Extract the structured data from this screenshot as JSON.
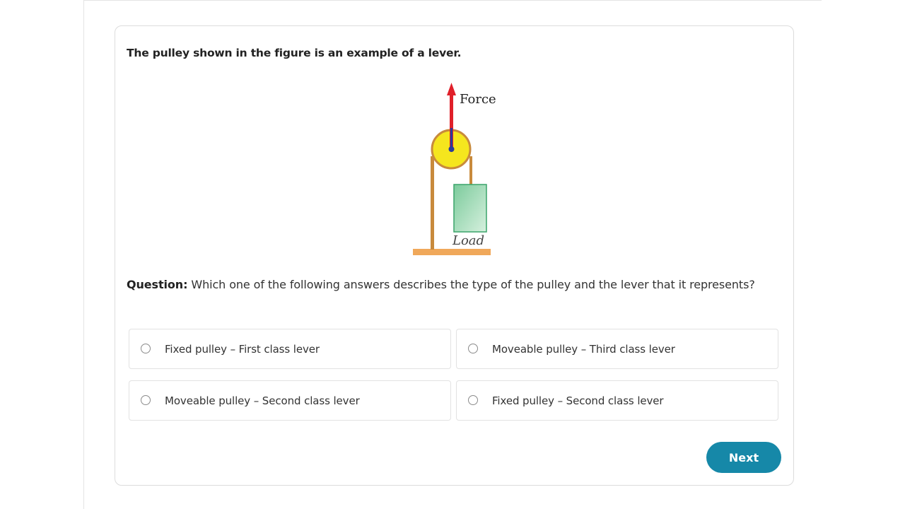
{
  "question_card": {
    "statement": "The pulley shown in the figure is an example of a lever.",
    "figure": {
      "force_label": "Force",
      "load_label": "Load"
    },
    "question_label": "Question:",
    "question_text": " Which one of the following answers describes the type of the pulley and the lever that it represents?",
    "options": [
      {
        "label": "Fixed pulley – First class lever",
        "selected": false
      },
      {
        "label": "Moveable pulley – Third class lever",
        "selected": false
      },
      {
        "label": "Moveable pulley – Second class lever",
        "selected": false
      },
      {
        "label": "Fixed pulley – Second class lever",
        "selected": false
      }
    ],
    "next_label": "Next"
  },
  "colors": {
    "accent": "#1688a8",
    "force_arrow": "#e0202a",
    "pulley_wheel": "#f2e21a",
    "rope": "#c88a3c",
    "load_box": "#9fd8b4"
  }
}
